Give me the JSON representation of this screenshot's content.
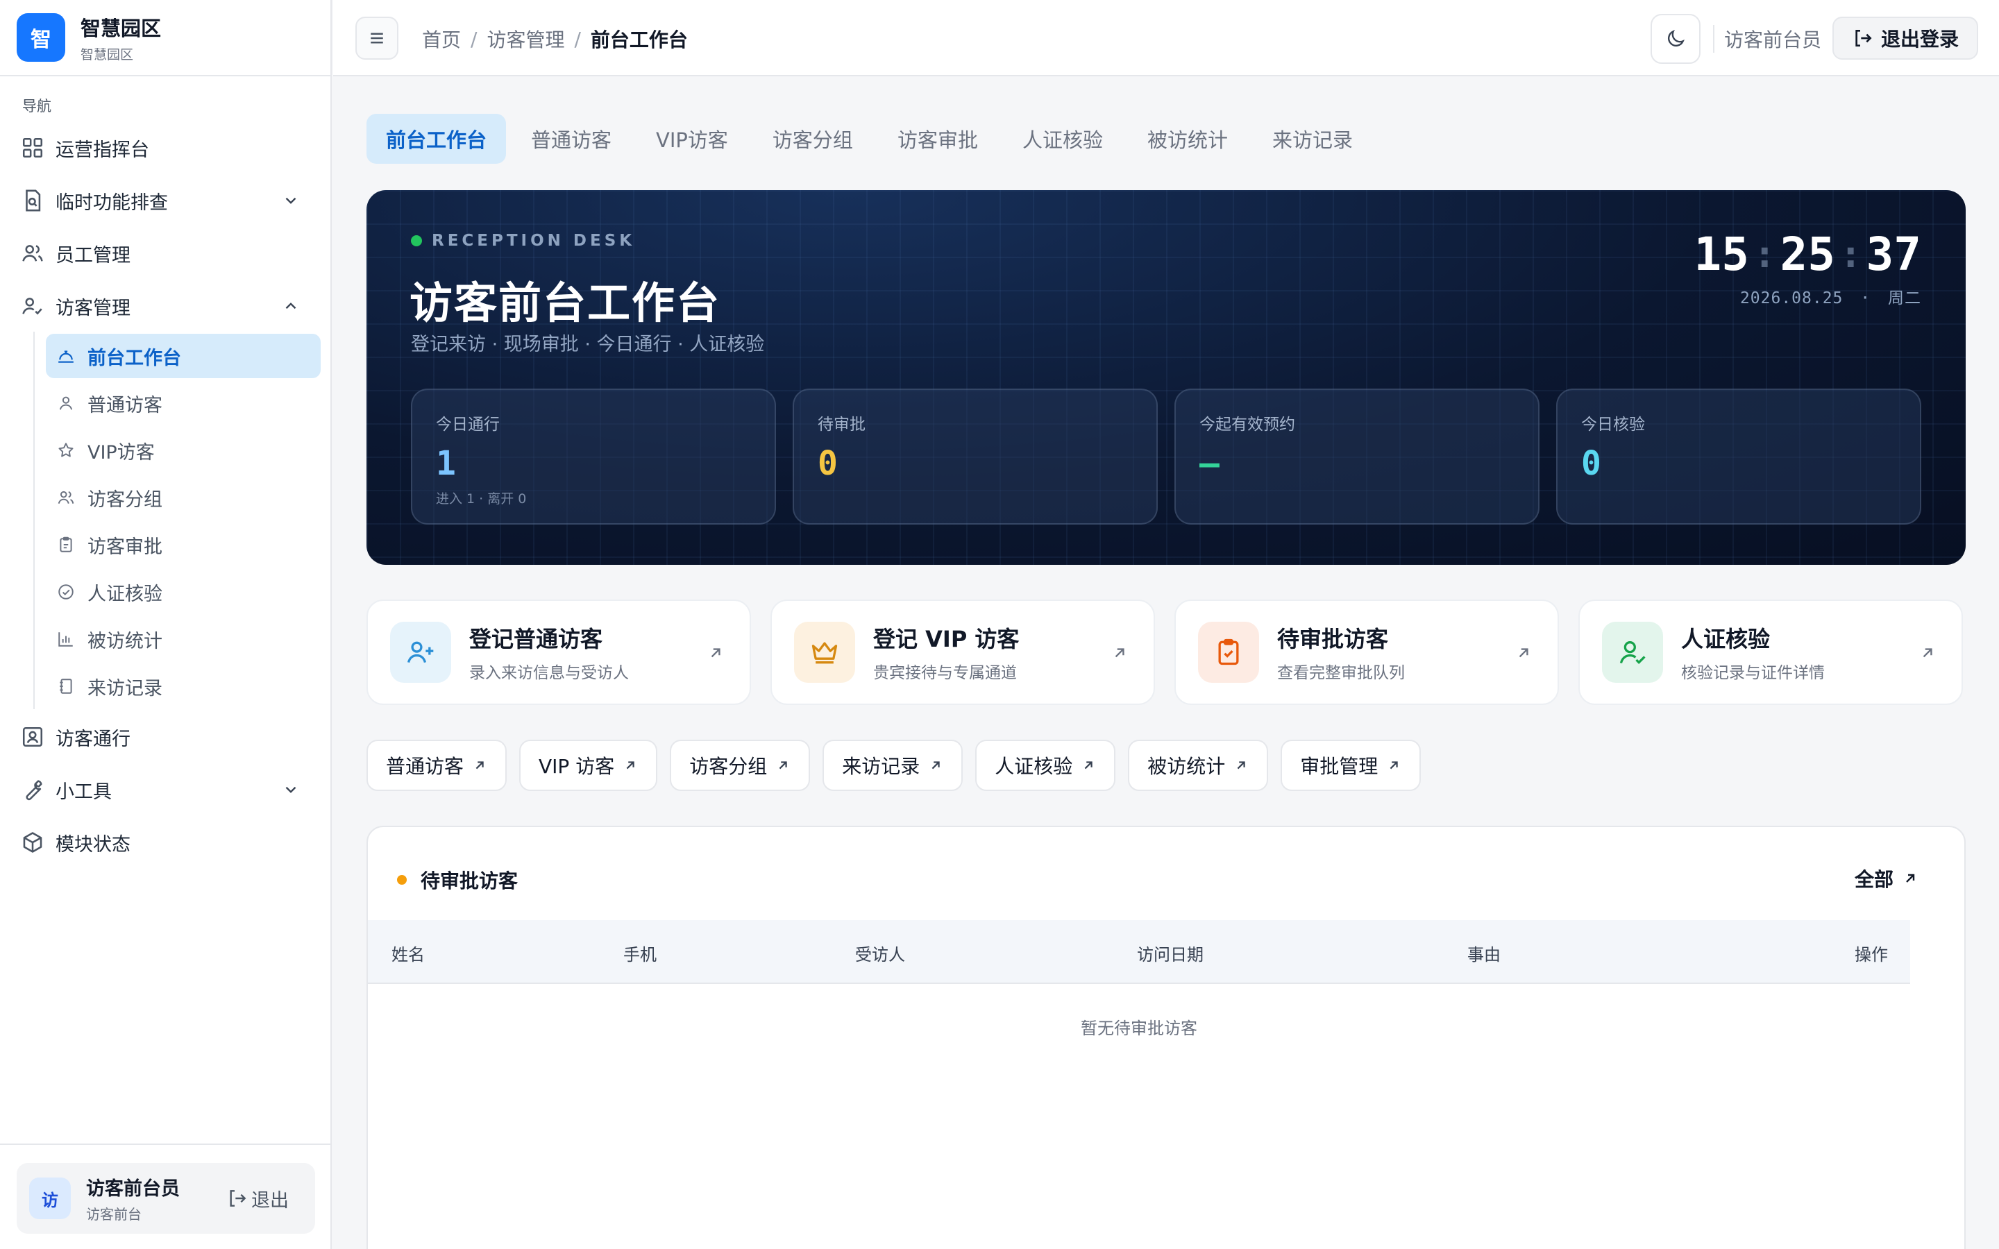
{
  "brand": {
    "logo_char": "智",
    "title": "智慧园区",
    "subtitle": "智慧园区"
  },
  "sidebar": {
    "caption": "导航",
    "items": [
      {
        "label": "运营指挥台",
        "icon": "dashboard-icon"
      },
      {
        "label": "临时功能排查",
        "icon": "file-search-icon",
        "expanded": false
      },
      {
        "label": "员工管理",
        "icon": "users-icon"
      },
      {
        "label": "访客管理",
        "icon": "user-check-icon",
        "expanded": true
      },
      {
        "label": "访客通行",
        "icon": "badge-icon"
      },
      {
        "label": "小工具",
        "icon": "wrench-icon",
        "expanded": false
      },
      {
        "label": "模块状态",
        "icon": "cube-icon"
      }
    ],
    "sub_items": [
      {
        "label": "前台工作台",
        "icon": "bell-desk-icon",
        "active": true
      },
      {
        "label": "普通访客",
        "icon": "user-icon"
      },
      {
        "label": "VIP访客",
        "icon": "star-icon"
      },
      {
        "label": "访客分组",
        "icon": "users-icon"
      },
      {
        "label": "访客审批",
        "icon": "clipboard-icon"
      },
      {
        "label": "人证核验",
        "icon": "check-circle-icon"
      },
      {
        "label": "被访统计",
        "icon": "bar-chart-icon"
      },
      {
        "label": "来访记录",
        "icon": "notebook-icon"
      }
    ]
  },
  "user_card": {
    "avatar_char": "访",
    "name": "访客前台员",
    "role": "访客前台",
    "logout": "退出"
  },
  "topbar": {
    "breadcrumb": [
      "首页",
      "访客管理",
      "前台工作台"
    ],
    "user": "访客前台员",
    "logout": "退出登录"
  },
  "tabs": [
    {
      "label": "前台工作台",
      "active": true
    },
    {
      "label": "普通访客"
    },
    {
      "label": "VIP访客"
    },
    {
      "label": "访客分组"
    },
    {
      "label": "访客审批"
    },
    {
      "label": "人证核验"
    },
    {
      "label": "被访统计"
    },
    {
      "label": "来访记录"
    }
  ],
  "hero": {
    "eyebrow": "RECEPTION DESK",
    "title": "访客前台工作台",
    "subtitle": "登记来访 · 现场审批 · 今日通行 · 人证核验",
    "clock": {
      "h": "15",
      "m": "25",
      "s": "37"
    },
    "date": "2026.08.25",
    "date_sep": "·",
    "weekday": "周二",
    "stats": [
      {
        "label": "今日通行",
        "value": "1",
        "note": "进入 1 · 离开 0",
        "color": "#7cc4ff"
      },
      {
        "label": "待审批",
        "value": "0",
        "note": "",
        "color": "#f5c542"
      },
      {
        "label": "今起有效预约",
        "value": "—",
        "note": "",
        "color": "#34d399"
      },
      {
        "label": "今日核验",
        "value": "0",
        "note": "",
        "color": "#5ad7f0"
      }
    ]
  },
  "actions": [
    {
      "title": "登记普通访客",
      "desc": "录入来访信息与受访人",
      "icon": "user-plus-icon",
      "bg": "#e6f3fb",
      "fg": "#2b8fd6"
    },
    {
      "title": "登记 VIP 访客",
      "desc": "贵宾接待与专属通道",
      "icon": "crown-icon",
      "bg": "#fdf1e0",
      "fg": "#d68910"
    },
    {
      "title": "待审批访客",
      "desc": "查看完整审批队列",
      "icon": "clipboard-check-icon",
      "bg": "#fdebe3",
      "fg": "#e8590c"
    },
    {
      "title": "人证核验",
      "desc": "核验记录与证件详情",
      "icon": "user-check-icon",
      "bg": "#e3f5ec",
      "fg": "#16a34a"
    }
  ],
  "quick_links": [
    "普通访客",
    "VIP 访客",
    "访客分组",
    "来访记录",
    "人证核验",
    "被访统计",
    "审批管理"
  ],
  "pending_panel": {
    "title": "待审批访客",
    "all": "全部",
    "columns": [
      "姓名",
      "手机",
      "受访人",
      "访问日期",
      "事由",
      "操作"
    ],
    "empty": "暂无待审批访客"
  }
}
